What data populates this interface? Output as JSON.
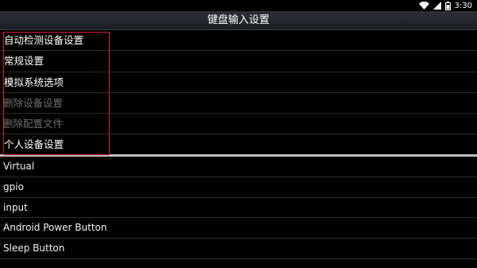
{
  "status_bar": {
    "time": "3:30",
    "icons": [
      "wifi-icon",
      "signal-icon",
      "battery-icon"
    ]
  },
  "title_bar": {
    "title": "键盘输入设置"
  },
  "settings_menu": {
    "items": [
      {
        "label": "自动检测设备设置",
        "enabled": true
      },
      {
        "label": "常规设置",
        "enabled": true
      },
      {
        "label": "模拟系统选项",
        "enabled": true
      },
      {
        "label": "删除设备设置",
        "enabled": false
      },
      {
        "label": "删除配置文件",
        "enabled": false
      },
      {
        "label": "个人设备设置",
        "enabled": true
      }
    ]
  },
  "devices": {
    "items": [
      {
        "label": "Virtual"
      },
      {
        "label": "gpio"
      },
      {
        "label": "input"
      },
      {
        "label": "Android Power Button"
      },
      {
        "label": "Sleep Button"
      }
    ]
  },
  "colors": {
    "background": "#000000",
    "highlight_box": "#d02027",
    "disabled_text": "#6f6f6f",
    "divider": "#bdbdbd"
  }
}
